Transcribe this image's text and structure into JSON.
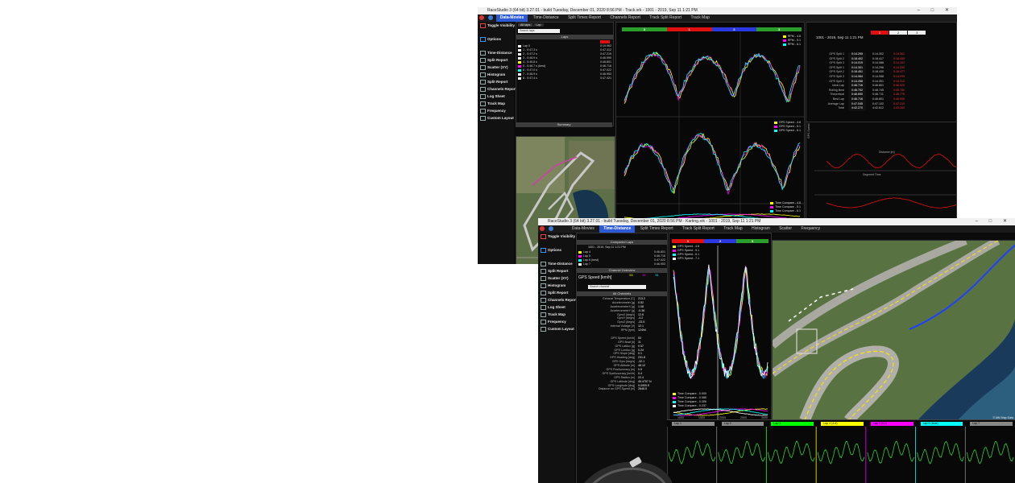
{
  "win1": {
    "title": "RaceStudio 3 (64 bit) 3.27.01 - build Tuesday, December 01, 2020 8:56 PM - Track.xrk - 1001 - 2019, Sep 11 1:21 PM",
    "tabs": [
      "Data-Movies",
      "Time-Distance",
      "Split Times Report",
      "Channels Report",
      "Track Split Report",
      "Track Map"
    ],
    "active_tab": "Data-Movies",
    "sidebar": [
      "Toggle Visibility",
      "Options",
      "Time-Distance",
      "Split Report",
      "Scatter (XY)",
      "Histogram",
      "Split Report",
      "Channels Report",
      "Log Sheet",
      "Track Map",
      "Frequency",
      "Custom Layout"
    ],
    "lap_panel": {
      "buttons": [
        "All laps",
        "Lap"
      ],
      "search": "Search laps",
      "header": "Laps",
      "rows": [
        {
          "name": "Lap 0",
          "time": "0:19.962",
          "color": "#ffffff"
        },
        {
          "name": "1 - 0:47.3 s",
          "time": "0:47.312",
          "color": "#ffffff"
        },
        {
          "name": "2 - 0:47.2 s",
          "time": "0:47.215",
          "color": "#ffffff"
        },
        {
          "name": "3 - 0:46.9 s",
          "time": "0:46.990",
          "color": "#ffffff"
        },
        {
          "name": "4 - 0:46.8 s",
          "time": "0:46.801",
          "color": "#ffff00"
        },
        {
          "name": "5 - 0:46.7 s (best)",
          "time": "0:46.716",
          "color": "#ff00ff"
        },
        {
          "name": "6 - 0:47.0 s",
          "time": "0:47.022",
          "color": "#00ffff"
        },
        {
          "name": "7 - 0:46.9 s",
          "time": "0:46.953",
          "color": "#ffffff"
        },
        {
          "name": "8 - 0:47.4 s",
          "time": "0:47.421",
          "color": "#ffffff"
        }
      ],
      "footer": "Summary"
    },
    "segments": [
      {
        "label": "3",
        "color": "#2a9d2a"
      },
      {
        "label": "1",
        "color": "#e01010"
      },
      {
        "label": "2",
        "color": "#2a3ae0"
      },
      {
        "label": "3",
        "color": "#2a9d2a"
      }
    ],
    "chart_legend_top": [
      "RPM - 4.8",
      "RPM - 5.1",
      "RPM - 6.1"
    ],
    "chart_legend_mid": [
      "GPS Speed - 4.8",
      "GPS Speed - 5.1",
      "GPS Speed - 6.1"
    ],
    "chart_legend_bot": [
      "Time Compare - 4.8",
      "Time Compare - 5.1",
      "Time Compare - 6.1"
    ],
    "report": {
      "date": "1001 - 2019, Sep 11 1:21 PM",
      "seg_labels": [
        "1",
        "2",
        "3"
      ],
      "rows": [
        [
          "GPS Split 1",
          "0:14.295",
          "0:14.302",
          "0:14.361"
        ],
        [
          "GPS Split 2",
          "0:18.402",
          "0:18.417",
          "0:18.455"
        ],
        [
          "GPS Split 3",
          "0:14.019",
          "0:14.088",
          "0:14.102"
        ],
        [
          "GPS Split 1",
          "0:14.301",
          "0:14.296",
          "0:14.330"
        ],
        [
          "GPS Split 2",
          "0:18.451",
          "0:18.430",
          "0:18.477"
        ],
        [
          "GPS Split 3",
          "0:14.064",
          "0:14.058",
          "0:14.099"
        ],
        [
          "GPS Split 1",
          "0:14.288",
          "0:14.301",
          "0:14.312"
        ],
        [
          "Ideal Lap",
          "0:46.716",
          "0:46.801",
          "0:46.920"
        ],
        [
          "Rolling Best",
          "0:46.702",
          "0:46.745",
          "0:46.780"
        ],
        [
          "Theoretical",
          "0:46.690",
          "0:46.711",
          "0:46.776"
        ],
        [
          "Best Lap",
          "0:46.716",
          "0:46.801",
          "0:46.990"
        ],
        [
          "Average Lap",
          "0:47.045",
          "0:47.102",
          "0:47.210"
        ],
        [
          "Total",
          "4:42.270",
          "4:42.612",
          "4:43.260"
        ]
      ]
    },
    "scatter_labels": [
      "GPS Speed",
      "Distance [m]",
      "Segment Time"
    ]
  },
  "win2": {
    "title": "RaceStudio 3 (64 bit) 3.27.01 - build Tuesday, December 01, 2020 8:56 PM - Karting.xrk - 1001 - 2019, Sep 11 1:21 PM",
    "tabs": [
      "Data-Movies",
      "Time-Distance",
      "Split Times Report",
      "Track Split Report",
      "Track Map",
      "Histogram",
      "Scatter",
      "Frequency"
    ],
    "active_tab": "Time-Distance",
    "sidebar": [
      "Toggle Visibility",
      "Options",
      "Time-Distance",
      "Split Report",
      "Scatter (XY)",
      "Histogram",
      "Split Report",
      "Channels Report",
      "Log Sheet",
      "Track Map",
      "Frequency",
      "Custom Layout"
    ],
    "compare": {
      "header": "Compared Laps",
      "session": "1001 - 2019, Sep 11 1:21 PM",
      "laps": [
        {
          "name": "Lap 4",
          "time": "0:46.801",
          "color": "#ffff00"
        },
        {
          "name": "Lap 5",
          "time": "0:46.716",
          "color": "#ff00ff"
        },
        {
          "name": "Lap 6 (best)",
          "time": "0:47.022",
          "color": "#00ffff"
        },
        {
          "name": "Lap 7",
          "time": "0:46.953",
          "color": "#ffffff"
        }
      ],
      "channel_hdr": "Channel Overview",
      "gps_title": "GPS Speed [km/h]",
      "values": [
        "53",
        "52",
        "51"
      ],
      "search": "Search channel",
      "channels_hdr": "All Channels"
    },
    "channels": [
      [
        "Exhaust Temperature [C]",
        "213.2"
      ],
      [
        "Accelerometer [g]",
        "0.52"
      ],
      [
        "AccelerometerX [g]",
        "1.08"
      ],
      [
        "AccelerometerY [g]",
        "-0.36"
      ],
      [
        "GyroX [deg/s]",
        "12.6"
      ],
      [
        "GyroY [deg/s]",
        "-4.2"
      ],
      [
        "GyroZ [deg/s]",
        "-33.5"
      ],
      [
        "Internal Voltage [V]",
        "12.1"
      ],
      [
        "RPM [rpm]",
        "12494"
      ],
      [
        "",
        ""
      ],
      [
        "GPS Speed [km/h]",
        "53"
      ],
      [
        "GPS Nsat [#]",
        "11"
      ],
      [
        "GPS LatAcc [g]",
        "0.57"
      ],
      [
        "GPS LonAcc [g]",
        "0.24"
      ],
      [
        "GPS Slope [deg]",
        "0.1"
      ],
      [
        "GPS Heading [deg]",
        "231.8"
      ],
      [
        "GPS Gyro [deg/s]",
        "-32.1"
      ],
      [
        "GPS Altitude [m]",
        "48.12"
      ],
      [
        "GPS PosAccuracy [m]",
        "0.9"
      ],
      [
        "GPS SpdAccuracy [km/h]",
        "0.4"
      ],
      [
        "GPS Radius [m]",
        "22.4"
      ],
      [
        "GPS Latitude [deg]",
        "45.4757 N"
      ],
      [
        "GPS Longitude [deg]",
        "9.0905 E"
      ],
      [
        "Distance on GPS Speed [m]",
        "2848.5"
      ]
    ],
    "segments": [
      {
        "label": "1",
        "color": "#e01010"
      },
      {
        "label": "2",
        "color": "#2a3ae0"
      },
      {
        "label": "3",
        "color": "#2a9d2a"
      }
    ],
    "chart_legend": [
      "GPS Speed - 4.8",
      "GPS Speed - 5.1",
      "GPS Speed - 6.1",
      "GPS Speed - 7.1"
    ],
    "chart_legend_bot": [
      "Time Compare - 0.000",
      "Time Compare - 0.085",
      "Time Compare - 0.306",
      "Time Compare - 0.237"
    ],
    "x_ticks": [
      "1000",
      "1500",
      "2000",
      "2500",
      "3000"
    ],
    "strip_labels": [
      "Lap 1",
      "Lap 2",
      "Lap 3",
      "Lap 4 (4.8)",
      "Lap 5 (5.1)",
      "Lap 6 (best)",
      "Lap 7"
    ],
    "strip_colors": [
      "#888888",
      "#888888",
      "#00ff00",
      "#ffff00",
      "#ff00ff",
      "#00ffff",
      "#888888"
    ],
    "map_credit": "© AiM Map Data"
  }
}
